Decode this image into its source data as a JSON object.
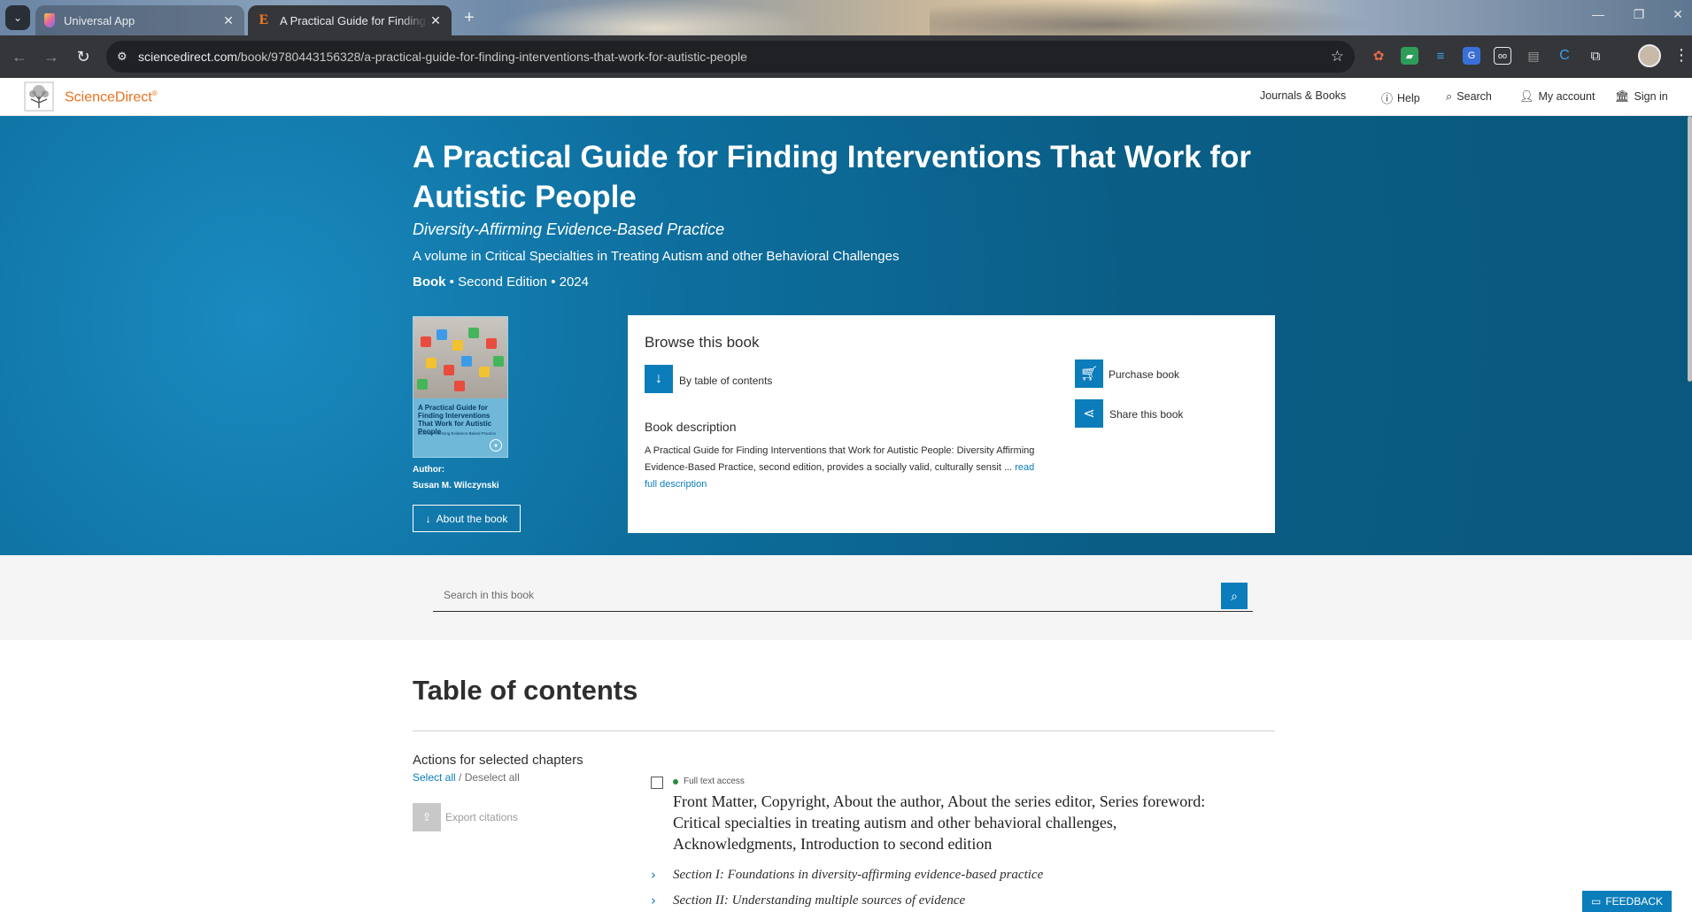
{
  "browser": {
    "tabs": [
      {
        "title": "Universal App",
        "icon": "app-icon"
      },
      {
        "title": "A Practical Guide for Finding In",
        "icon": "elsevier-icon"
      }
    ],
    "url_domain": "sciencedirect.com",
    "url_path": "/book/9780443156328/a-practical-guide-for-finding-interventions-that-work-for-autistic-people"
  },
  "site": {
    "logo_text": "ScienceDirect",
    "logo_mark": "®",
    "nav": {
      "journals": "Journals & Books",
      "help": "Help",
      "search": "Search",
      "account": "My account",
      "signin": "Sign in"
    }
  },
  "book": {
    "title": "A Practical Guide for Finding Interventions That Work for Autistic People",
    "subtitle": "Diversity-Affirming Evidence-Based Practice",
    "series": "A volume in Critical Specialties in Treating Autism and other Behavioral Challenges",
    "type": "Book",
    "edition": "Second Edition",
    "year": "2024",
    "sep": "•",
    "author_label": "Author:",
    "author": "Susan M. Wilczynski",
    "about_button": "About the book",
    "cover": {
      "title": "A Practical Guide for Finding Interventions That Work for Autistic People",
      "subtitle": "Diversity-Affirming Evidence-Based Practice"
    }
  },
  "browse": {
    "heading": "Browse this book",
    "toc_link": "By table of contents",
    "desc_heading": "Book description",
    "description": "A Practical Guide for Finding Interventions that Work for Autistic People: Diversity Affirming Evidence-Based Practice, second edition, provides a socially valid, culturally sensit ...",
    "read_more": "read full description",
    "purchase": "Purchase book",
    "share": "Share this book"
  },
  "search": {
    "placeholder": "Search in this book"
  },
  "toc": {
    "title": "Table of contents",
    "actions_heading": "Actions for selected chapters",
    "select_all": "Select all",
    "slash": "/",
    "deselect_all": "Deselect all",
    "export": "Export citations",
    "access": "Full text access",
    "front_matter": "Front Matter, Copyright, About the author, About the series editor, Series foreword: Critical specialties in treating autism and other behavioral challenges, Acknowledgments, Introduction to second edition",
    "sections": [
      "Section I: Foundations in diversity-affirming evidence-based practice",
      "Section II: Understanding multiple sources of evidence"
    ]
  },
  "feedback": "FEEDBACK",
  "colors": {
    "accent": "#0c7dbb",
    "hero": "#0a5e86",
    "brand_orange": "#e9711c"
  }
}
